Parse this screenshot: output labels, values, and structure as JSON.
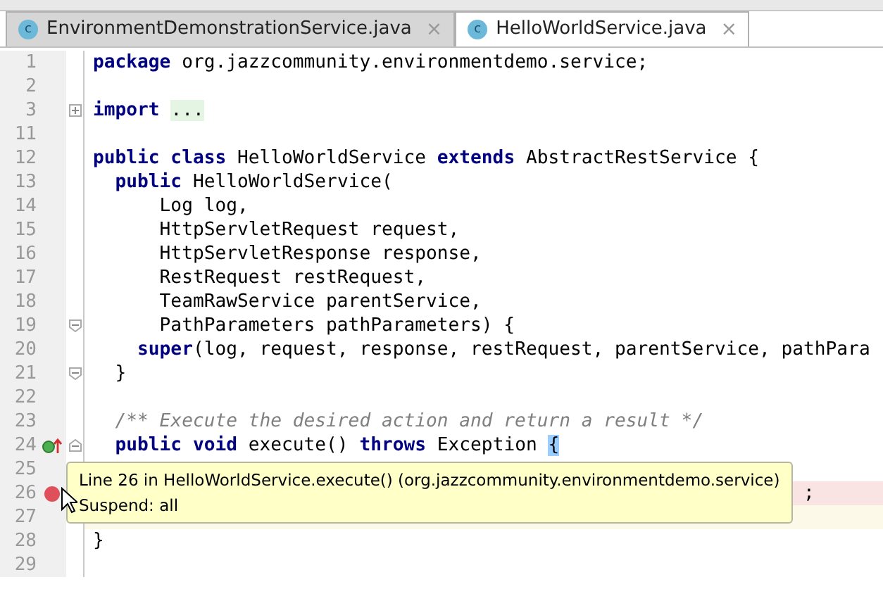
{
  "tabs": [
    {
      "label": "EnvironmentDemonstrationService.java",
      "icon": "c",
      "close": "×",
      "selected": false
    },
    {
      "label": "HelloWorldService.java",
      "icon": "c",
      "close": "×",
      "selected": true
    }
  ],
  "editor": {
    "lines": [
      {
        "number": "1",
        "kind": "normal",
        "tokens": [
          {
            "kind": "keyword",
            "text": "package"
          },
          {
            "kind": "plain",
            "text": " org.jazzcommunity.environmentdemo.service;"
          }
        ]
      },
      {
        "number": "2",
        "kind": "normal"
      },
      {
        "number": "3",
        "kind": "normal",
        "fold_marker": {
          "kind": "collapsed"
        },
        "tokens": [
          {
            "kind": "keyword",
            "text": "import "
          },
          {
            "kind": "folded",
            "text": "..."
          }
        ]
      },
      {
        "number": "11",
        "kind": "normal"
      },
      {
        "number": "12",
        "kind": "normal",
        "tokens": [
          {
            "kind": "keyword",
            "text": "public class"
          },
          {
            "kind": "plain",
            "text": " HelloWorldService "
          },
          {
            "kind": "keyword",
            "text": "extends"
          },
          {
            "kind": "plain",
            "text": " AbstractRestService {"
          }
        ]
      },
      {
        "number": "13",
        "kind": "normal",
        "tokens": [
          {
            "kind": "keyword",
            "text": "  public"
          },
          {
            "kind": "plain",
            "text": " HelloWorldService("
          }
        ]
      },
      {
        "number": "14",
        "kind": "normal",
        "tokens": [
          {
            "kind": "plain",
            "text": "      Log log,"
          }
        ]
      },
      {
        "number": "15",
        "kind": "normal",
        "tokens": [
          {
            "kind": "plain",
            "text": "      HttpServletRequest request,"
          }
        ]
      },
      {
        "number": "16",
        "kind": "normal",
        "tokens": [
          {
            "kind": "plain",
            "text": "      HttpServletResponse response,"
          }
        ]
      },
      {
        "number": "17",
        "kind": "normal",
        "tokens": [
          {
            "kind": "plain",
            "text": "      RestRequest restRequest,"
          }
        ]
      },
      {
        "number": "18",
        "kind": "normal",
        "tokens": [
          {
            "kind": "plain",
            "text": "      TeamRawService parentService,"
          }
        ]
      },
      {
        "number": "19",
        "kind": "normal",
        "fold_marker": {
          "kind": "end"
        },
        "tokens": [
          {
            "kind": "plain",
            "text": "      PathParameters pathParameters) {"
          }
        ]
      },
      {
        "number": "20",
        "kind": "normal",
        "tokens": [
          {
            "kind": "keyword",
            "text": "    super"
          },
          {
            "kind": "plain",
            "text": "(log, request, response, restRequest, parentService, pathPara"
          }
        ]
      },
      {
        "number": "21",
        "kind": "normal",
        "fold_marker": {
          "kind": "end"
        },
        "tokens": [
          {
            "kind": "plain",
            "text": "  }"
          }
        ]
      },
      {
        "number": "22",
        "kind": "normal"
      },
      {
        "number": "23",
        "kind": "normal",
        "tokens": [
          {
            "kind": "comment",
            "text": "  /** Execute the desired action and return a result */"
          }
        ]
      },
      {
        "number": "24",
        "kind": "normal",
        "fold_marker": {
          "kind": "start"
        },
        "gutter_icon": {
          "kind": "override"
        },
        "tokens": [
          {
            "kind": "keyword",
            "text": "  public void"
          },
          {
            "kind": "plain",
            "text": " execute() "
          },
          {
            "kind": "keyword",
            "text": "throws"
          },
          {
            "kind": "plain",
            "text": " Exception "
          },
          {
            "kind": "brace",
            "text": "{"
          }
        ]
      },
      {
        "number": "25",
        "kind": "normal"
      },
      {
        "number": "26",
        "kind": "breakpoint",
        "gutter_icon": {
          "kind": "breakpoint"
        },
        "tokens": [
          {
            "kind": "tail",
            "text": ";"
          }
        ]
      },
      {
        "number": "27",
        "kind": "current"
      },
      {
        "number": "28",
        "kind": "normal",
        "tokens": [
          {
            "kind": "plain",
            "text": "}"
          }
        ]
      },
      {
        "number": "29",
        "kind": "normal"
      }
    ]
  },
  "tooltip": {
    "title": "Line 26 in HelloWorldService.execute() (org.jazzcommunity.environmentdemo.service)",
    "detail": "Suspend: all"
  }
}
